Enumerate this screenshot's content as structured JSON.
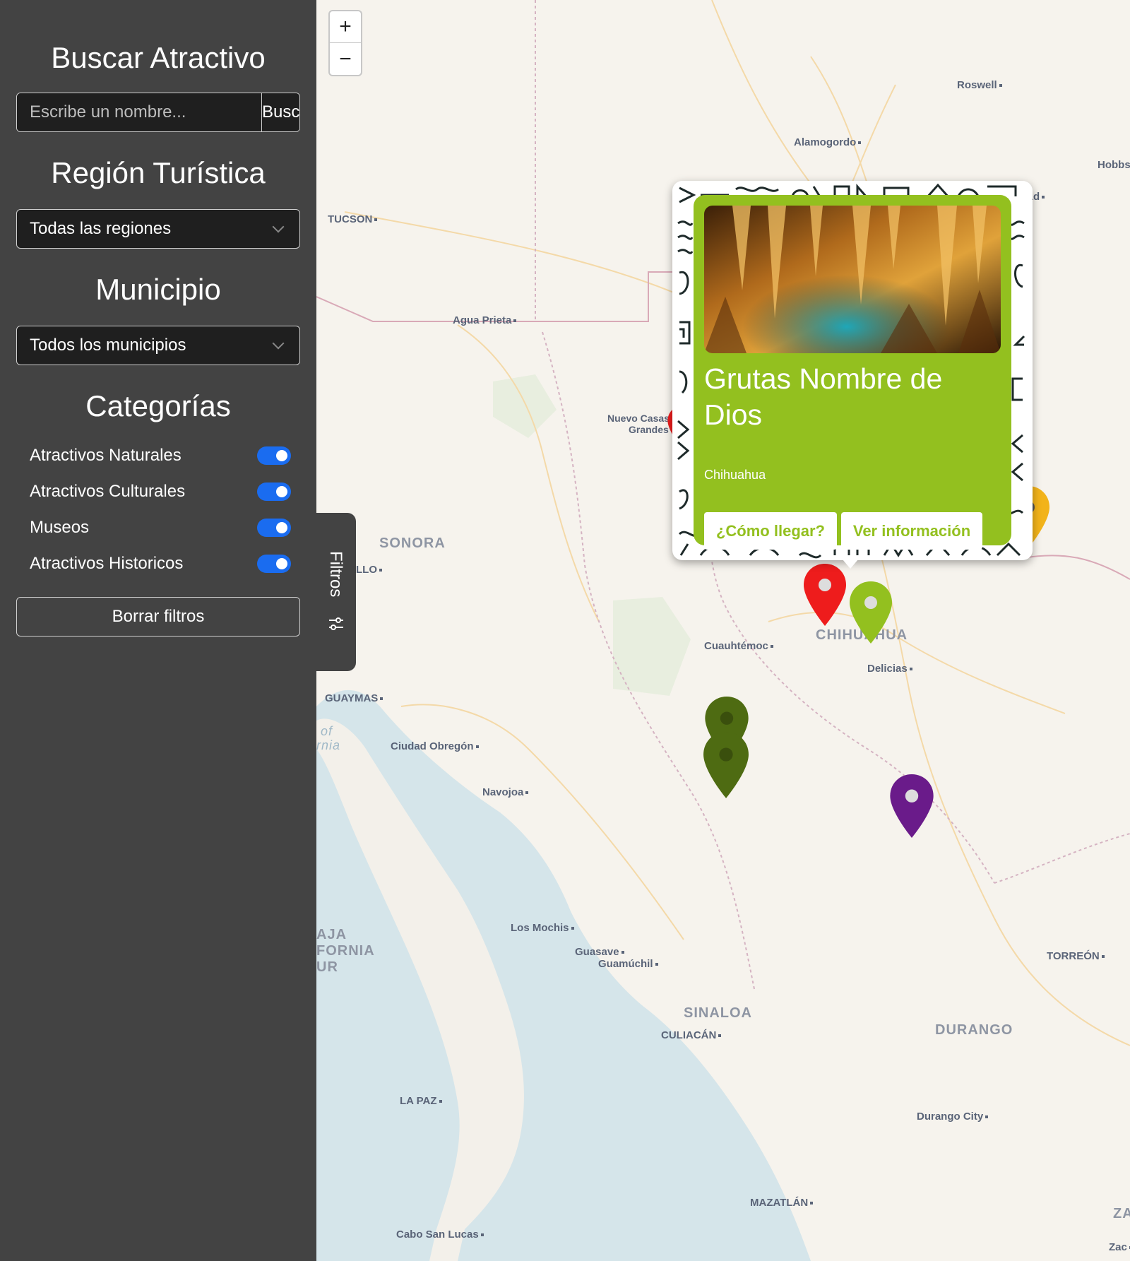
{
  "sidebar": {
    "search_title": "Buscar Atractivo",
    "search_placeholder": "Escribe un nombre...",
    "search_button": "Buscar",
    "region_title": "Región Turística",
    "region_selected": "Todas las regiones",
    "municipio_title": "Municipio",
    "municipio_selected": "Todos los municipios",
    "categories_title": "Categorías",
    "categories": [
      {
        "label": "Atractivos Naturales",
        "enabled": true
      },
      {
        "label": "Atractivos Culturales",
        "enabled": true
      },
      {
        "label": "Museos",
        "enabled": true
      },
      {
        "label": "Atractivos Historicos",
        "enabled": true
      }
    ],
    "clear_button": "Borrar filtros"
  },
  "filter_tab": {
    "label": "Filtros",
    "icon": "sliders-icon"
  },
  "zoom": {
    "in_label": "+",
    "out_label": "−"
  },
  "map": {
    "cities": [
      "Roswell",
      "Alamogordo",
      "Hobbs",
      "TUCSON",
      "Agua Prieta",
      "Nuevo Casas",
      "Grandes",
      "LLO",
      "Cuauhtémoc",
      "Delicias",
      "GUAYMAS",
      "Ciudad Obregón",
      "Navojoa",
      "Los Mochis",
      "Guasave",
      "Guamúchil",
      "CULIACÁN",
      "TORREÓN",
      "LA PAZ",
      "Durango City",
      "MAZATLÁN",
      "Cabo San Lucas",
      "Carlsbad",
      "Zac"
    ],
    "states": [
      "SONORA",
      "CHIHUAHUA",
      "SINALOA",
      "DURANGO",
      "AJA",
      "FORNIA",
      "UR",
      "ZA"
    ],
    "water_labels": [
      "of",
      "rnia"
    ],
    "pin_colors": {
      "red": "#ee1c1c",
      "light_green": "#93c01f",
      "dark_green": "#4e6b12",
      "purple": "#6a1b8a",
      "yellow": "#f2b31a"
    }
  },
  "popup": {
    "title": "Grutas Nombre de Dios",
    "subtitle": "Chihuahua",
    "directions_button": "¿Cómo llegar?",
    "info_button": "Ver información",
    "card_color": "#93c01f"
  }
}
